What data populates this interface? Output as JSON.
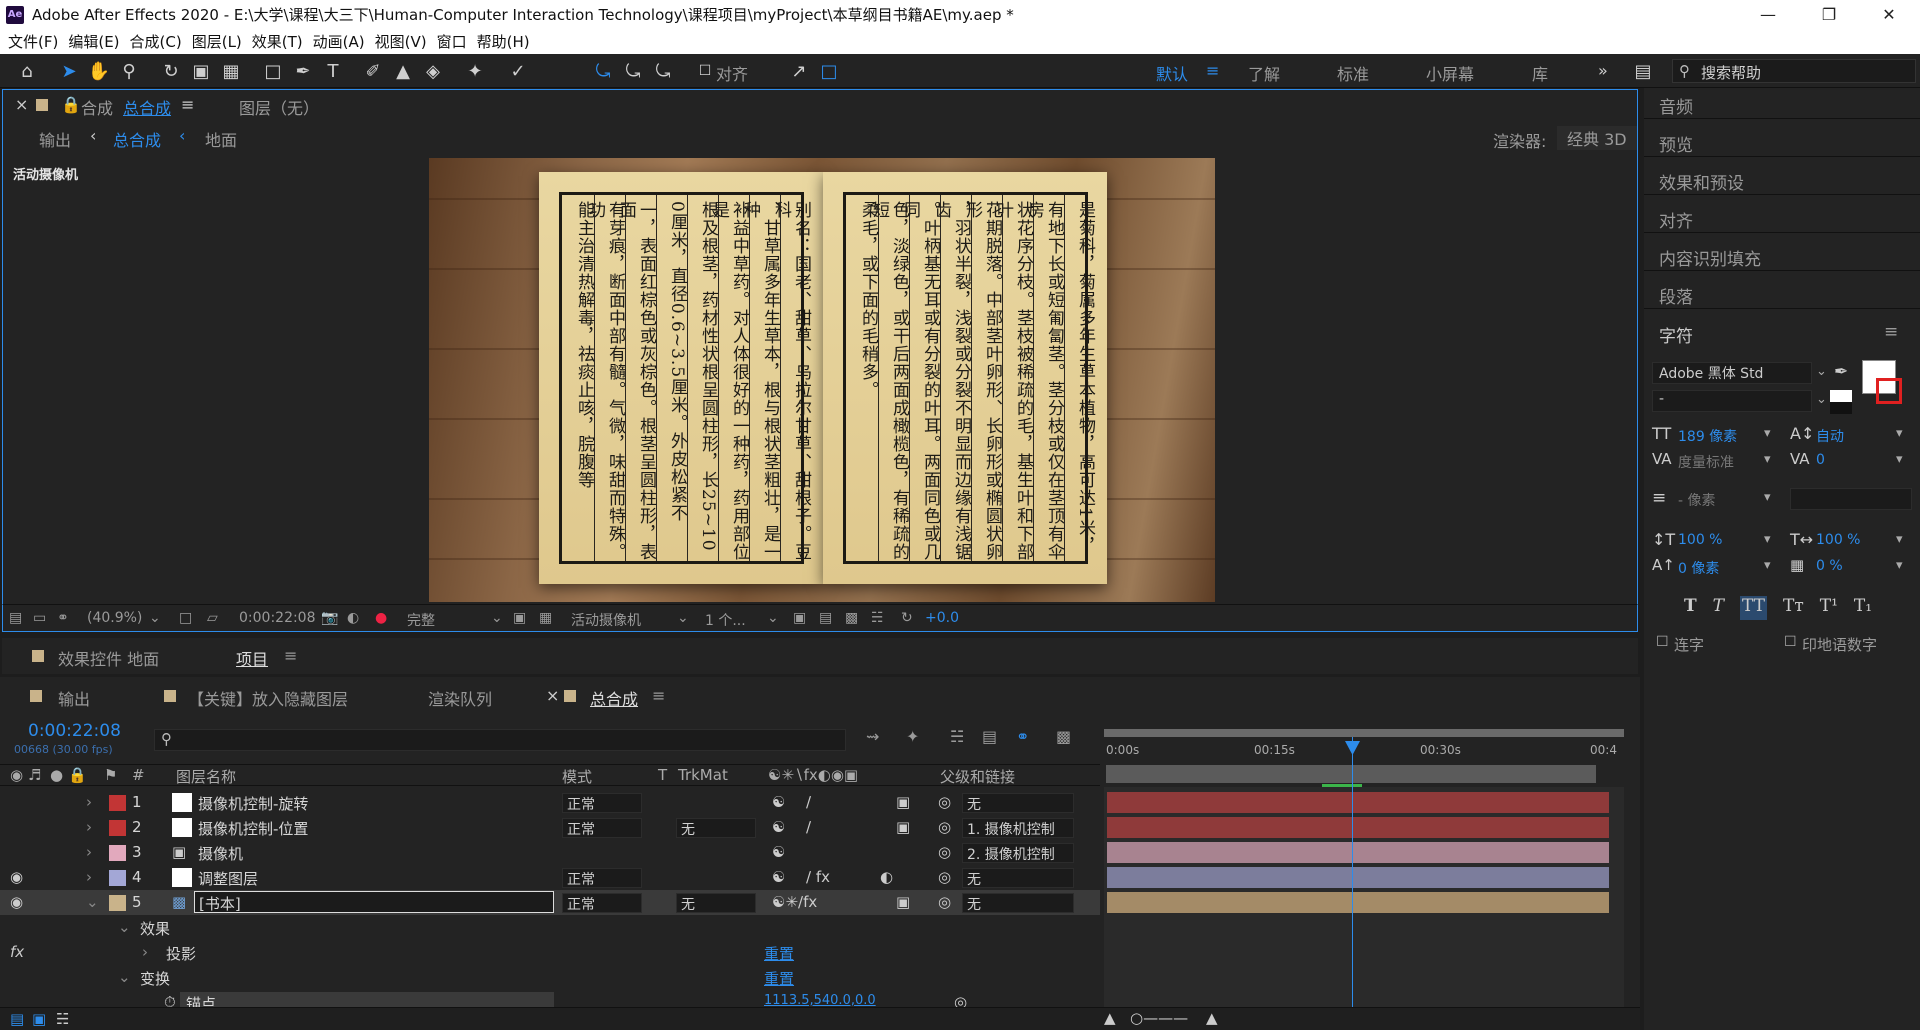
{
  "window": {
    "title": "Adobe After Effects 2020 - E:\\大学\\课程\\大三下\\Human-Computer Interaction Technology\\课程项目\\myProject\\本草纲目书籍AE\\my.aep *",
    "logo": "Ae"
  },
  "menu": [
    "文件(F)",
    "编辑(E)",
    "合成(C)",
    "图层(L)",
    "效果(T)",
    "动画(A)",
    "视图(V)",
    "窗口",
    "帮助(H)"
  ],
  "toolbar": {
    "align_label": "对齐",
    "workspaces": [
      "默认",
      "了解",
      "标准",
      "小屏幕",
      "库"
    ],
    "more": "»",
    "search_placeholder": "搜索帮助"
  },
  "comp_panel": {
    "tab_prefix": "合成",
    "tab_name": "总合成",
    "layer_tab": "图层（无）",
    "breadcrumbs": [
      "输出",
      "总合成",
      "地面"
    ],
    "renderer_label": "渲染器:",
    "renderer_value": "经典 3D",
    "camera_label": "活动摄像机"
  },
  "book": {
    "left_page": [
      "别名：国老、甜草、乌拉尔甘草、甜根子。豆科",
      "、甘草属多年生草本，根与根状茎粗壮，是一种",
      "补益中草药。对人体很好的一种药，药用部位是",
      "根及根茎，药材性状根呈圆柱形，长25~10",
      "0厘米，直径0.6~3.5厘米。外皮松紧不",
      "一，表面红棕色或灰棕色。根茎呈圆柱形，表面",
      "有芽痕，断面中部有髓。气微，味甜而特殊。功",
      "能主治清热解毒，祛痰止咳，脘腹等"
    ],
    "right_page": [
      "是菊科，菊属多年生草本植物，高可达1米，",
      "有地下长或短匍匐茎。茎分枝或仅在茎顶有伞房",
      "状花序分枝。茎枝被稀疏的毛，基生叶和下部叶",
      "花期脱落。中部茎叶卵形、长卵形或椭圆状卵形",
      "，羽状半裂，浅裂或分裂不明显而边缘有浅锯齿",
      "。叶柄基无耳或有分裂的叶耳。两面同色或几同",
      "色，淡绿色，或干后两面成橄榄色，有稀疏的短",
      "柔毛，或下面的毛稍多。"
    ]
  },
  "viewer_footer": {
    "zoom": "(40.9%)",
    "timecode": "0:00:22:08",
    "resolution": "完整",
    "camera": "活动摄像机",
    "views": "1 个...",
    "exposure": "+0.0"
  },
  "mid_tabs": {
    "effects_controls": "效果控件 地面",
    "project": "项目"
  },
  "timeline": {
    "tabs": [
      "输出",
      "【关键】放入隐藏图层",
      "渲染队列",
      "总合成"
    ],
    "timecode": "0:00:22:08",
    "frames_info": "00668 (30.00 fps)",
    "search_placeholder": "",
    "columns": {
      "layer_name": "图层名称",
      "mode": "模式",
      "t": "T",
      "trkmat": "TrkMat",
      "parent": "父级和链接"
    },
    "ruler": [
      "0:00s",
      "00:15s",
      "00:30s",
      "00:4"
    ],
    "layers": [
      {
        "index": "1",
        "name": "摄像机控制-旋转",
        "mode": "正常",
        "trkmat": "",
        "parent": "无",
        "label_color": "#c23535",
        "bar_color": "#8f3a3a",
        "visible": false,
        "icon": "solid"
      },
      {
        "index": "2",
        "name": "摄像机控制-位置",
        "mode": "正常",
        "trkmat": "无",
        "parent": "1. 摄像机控制",
        "label_color": "#c23535",
        "bar_color": "#8f3a3a",
        "visible": false,
        "icon": "solid"
      },
      {
        "index": "3",
        "name": "摄像机",
        "mode": "",
        "trkmat": "",
        "parent": "2. 摄像机控制",
        "label_color": "#e2a9bd",
        "bar_color": "#a88390",
        "visible": false,
        "icon": "camera"
      },
      {
        "index": "4",
        "name": "调整图层",
        "mode": "正常",
        "trkmat": "",
        "parent": "无",
        "label_color": "#a3a7d6",
        "bar_color": "#7c7d9c",
        "visible": true,
        "icon": "solid"
      },
      {
        "index": "5",
        "name": "[书本]",
        "mode": "正常",
        "trkmat": "无",
        "parent": "无",
        "label_color": "#c9b38a",
        "bar_color": "#a48b67",
        "visible": true,
        "icon": "comp"
      }
    ],
    "properties": {
      "effects": "效果",
      "drop_shadow": "投影",
      "reset1": "重置",
      "transform": "变换",
      "reset2": "重置",
      "anchor": "锚点",
      "anchor_value": "1113.5,540.0,0.0"
    }
  },
  "right_panel": {
    "sections": [
      "音频",
      "预览",
      "效果和预设",
      "对齐",
      "内容识别填充",
      "段落"
    ],
    "character": {
      "title": "字符",
      "font": "Adobe 黑体 Std",
      "style": "-",
      "font_size": "189 像素",
      "leading": "自动",
      "kerning": "度量标准",
      "tracking": "0",
      "stroke_width": "- 像素",
      "vscale": "100 %",
      "hscale": "100 %",
      "baseline": "0 像素",
      "tsume": "0 %",
      "ligature": "连字",
      "hindi_digits": "印地语数字"
    }
  },
  "colors": {
    "accent": "#2d8ceb",
    "playhead": "#2d8ceb"
  }
}
